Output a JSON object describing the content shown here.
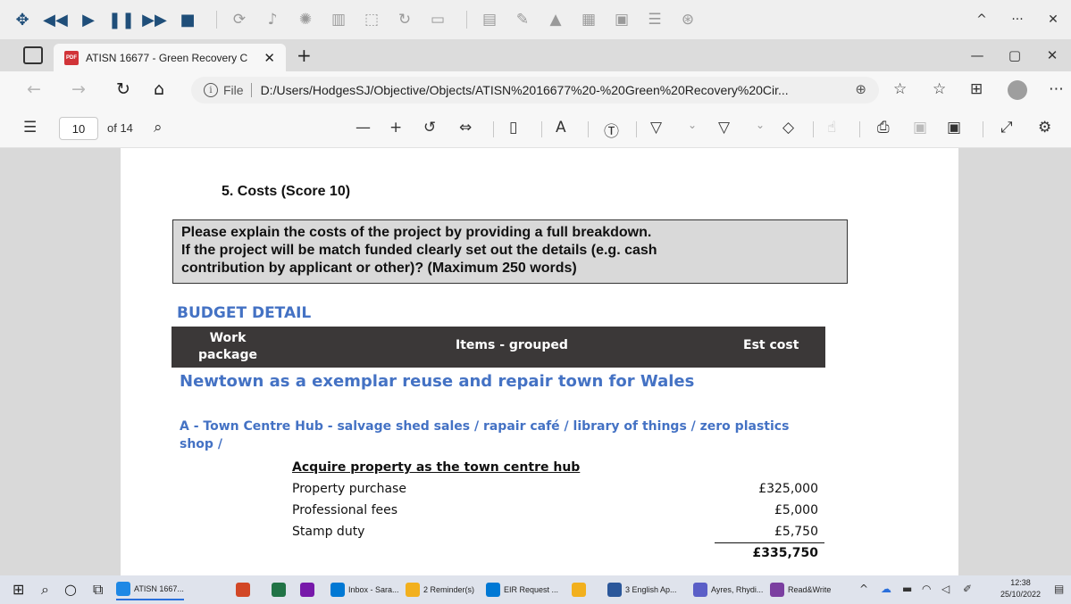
{
  "media_toolbar": {
    "icons": [
      "move-icon",
      "rewind-icon",
      "play-icon",
      "pause-icon",
      "fast-forward-icon",
      "stop-icon",
      "refresh-icon",
      "voice-icon",
      "lightbulb-icon",
      "reading-icon",
      "select-icon",
      "loop-icon",
      "screen-icon",
      "pdf-icon",
      "highlighter-icon",
      "highlight-dropdown-icon",
      "image-icon",
      "translate-icon",
      "picture-icon",
      "list-icon",
      "settings-icon"
    ],
    "right_icons": [
      "^",
      "···",
      "✕"
    ]
  },
  "tab": {
    "title": "ATISN 16677 - Green Recovery C",
    "close": "✕",
    "new_tab": "+"
  },
  "window_controls": [
    "—",
    "▢",
    "✕"
  ],
  "address_bar": {
    "scheme": "File",
    "url": "D:/Users/HodgesSJ/Objective/Objects/ATISN%2016677%20-%20Green%20Recovery%20Cir..."
  },
  "pdf_toolbar": {
    "page_number": "10",
    "page_of": "of 14",
    "zoom_out": "—",
    "zoom_in": "+"
  },
  "document": {
    "section_title": "5.  Costs (Score 10)",
    "question_lines": [
      "Please explain the costs of the project by providing a full breakdown.",
      "If the project will be match funded clearly set out the details (e.g. cash",
      "contribution by applicant or other)? (Maximum 250 words)"
    ],
    "budget_heading": "BUDGET DETAIL",
    "table_header": {
      "work_package_1": "Work",
      "work_package_2": "package",
      "items": "Items - grouped",
      "est_cost": "Est cost"
    },
    "project_heading": "Newtown as a exemplar reuse and repair town for Wales",
    "section_a": "A - Town Centre Hub - salvage shed sales / rapair café / library of things / zero plastics shop /",
    "acquire_heading": "Acquire property as the town centre hub",
    "rows": [
      {
        "label": "Property purchase",
        "cost": "£325,000"
      },
      {
        "label": "Professional fees",
        "cost": "£5,000"
      },
      {
        "label": "Stamp duty",
        "cost": "£5,750"
      }
    ],
    "total": "£335,750"
  },
  "taskbar": {
    "items": [
      {
        "label": "ATISN 1667...",
        "color": "#1e88e5"
      },
      {
        "label": "",
        "color": "#d24726"
      },
      {
        "label": "",
        "color": "#217346"
      },
      {
        "label": "",
        "color": "#7719aa"
      },
      {
        "label": "Inbox - Sara...",
        "color": "#0078d4"
      },
      {
        "label": "2 Reminder(s)",
        "color": "#f2b01e"
      },
      {
        "label": "EIR Request ...",
        "color": "#0078d4"
      },
      {
        "label": "",
        "color": "#f2b01e"
      },
      {
        "label": "3 English Ap...",
        "color": "#2b579a"
      },
      {
        "label": "Ayres, Rhydi...",
        "color": "#5b5fc7"
      },
      {
        "label": "Read&Write",
        "color": "#7b3fa0"
      }
    ],
    "time": "12:38",
    "date": "25/10/2022"
  }
}
